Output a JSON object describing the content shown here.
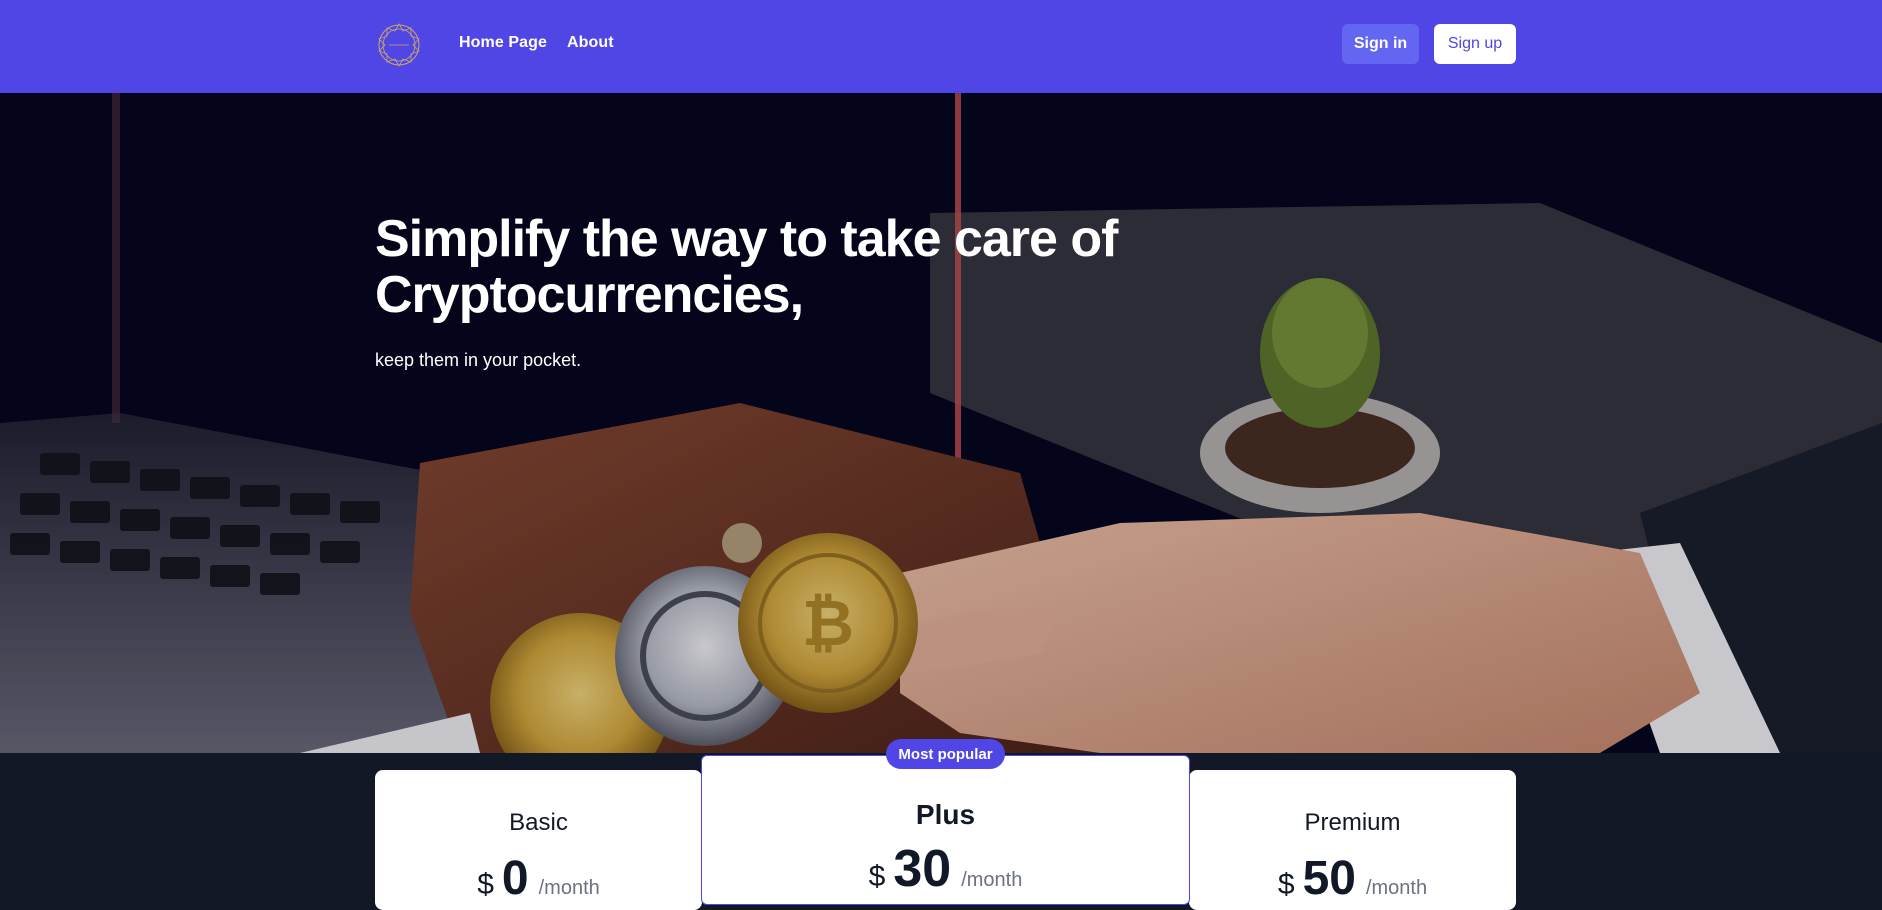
{
  "nav": {
    "logo_alt": "Site logo",
    "links": [
      {
        "label": "Home Page"
      },
      {
        "label": "About"
      }
    ],
    "signin_label": "Sign in",
    "signup_label": "Sign up"
  },
  "hero": {
    "title": "Simplify the way to take care of Cryptocurrencies,",
    "subtitle": "keep them in your pocket."
  },
  "pricing": {
    "badge": "Most popular",
    "plans": [
      {
        "name": "Basic",
        "currency": "$",
        "amount": "0",
        "period": "/month"
      },
      {
        "name": "Plus",
        "currency": "$",
        "amount": "30",
        "period": "/month"
      },
      {
        "name": "Premium",
        "currency": "$",
        "amount": "50",
        "period": "/month"
      }
    ]
  },
  "colors": {
    "brand": "#4f46e5",
    "brand_light": "#6366f1",
    "dark_bg": "#121826",
    "hero_bg": "#05051c"
  }
}
